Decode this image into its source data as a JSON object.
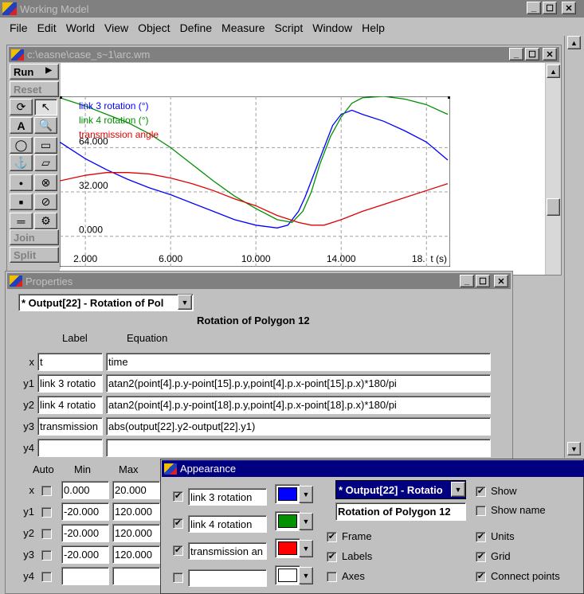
{
  "app": {
    "title": "Working Model"
  },
  "menu": [
    "File",
    "Edit",
    "World",
    "View",
    "Object",
    "Define",
    "Measure",
    "Script",
    "Window",
    "Help"
  ],
  "doc": {
    "title": "c:\\easne\\case_s~1\\arc.wm"
  },
  "toolbar": {
    "run": "Run",
    "reset": "Reset",
    "join": "Join",
    "split": "Split"
  },
  "legend_tabs": [
    "lin",
    "lin",
    "tra"
  ],
  "chart_data": {
    "type": "line",
    "x_label": "t (s)",
    "xlim": [
      0.8,
      19.0
    ],
    "ylim": [
      -22,
      101
    ],
    "x_ticks": [
      {
        "v": 2,
        "label": "2.000"
      },
      {
        "v": 6,
        "label": "6.000"
      },
      {
        "v": 10,
        "label": "10.000"
      },
      {
        "v": 14,
        "label": "14.000"
      },
      {
        "v": 18,
        "label": "18.000"
      }
    ],
    "x_unit_label": "t (s)",
    "y_ticks": [
      {
        "v": 0,
        "label": "0.000"
      },
      {
        "v": 32,
        "label": "32.000"
      },
      {
        "v": 64,
        "label": "64.000"
      }
    ],
    "series": [
      {
        "name": "link 3 rotation (°)",
        "color": "#0000ff",
        "x": [
          0.8,
          2,
          3,
          4,
          5,
          6,
          7,
          8,
          9,
          10,
          11,
          11.5,
          12,
          12.3,
          12.6,
          13,
          13.3,
          13.6,
          14,
          14.5,
          15,
          16,
          17,
          18,
          19
        ],
        "y": [
          68,
          56,
          48,
          41,
          35,
          30,
          24,
          18,
          12,
          8,
          6,
          8,
          18,
          28,
          40,
          56,
          68,
          80,
          88,
          91,
          88,
          83,
          76,
          68,
          55
        ]
      },
      {
        "name": "link 4 rotation (°)",
        "color": "#009000",
        "x": [
          0.8,
          2,
          3,
          4,
          5,
          6,
          7,
          8,
          9,
          10,
          11,
          11.7,
          12.2,
          12.6,
          13,
          13.5,
          14,
          14.5,
          15,
          16,
          17,
          18,
          19
        ],
        "y": [
          100,
          94,
          88,
          82,
          74,
          64,
          52,
          40,
          29,
          20,
          12,
          10,
          18,
          32,
          52,
          72,
          86,
          96,
          100,
          101,
          99,
          95,
          88
        ]
      },
      {
        "name": "transmission angle",
        "color": "#e00000",
        "x": [
          0.8,
          2,
          3,
          4,
          5,
          6,
          7,
          8,
          9,
          10,
          11,
          12,
          12.6,
          13.2,
          14,
          15,
          16,
          17,
          18,
          19
        ],
        "y": [
          40,
          44,
          46,
          46,
          45,
          42,
          38,
          33,
          27,
          22,
          15,
          10,
          8,
          8,
          12,
          18,
          23,
          28,
          33,
          38
        ]
      }
    ]
  },
  "properties": {
    "title": "Properties",
    "selector": "* Output[22] - Rotation of Pol",
    "heading": "Rotation of Polygon 12",
    "col_label": "Label",
    "col_equation": "Equation",
    "rows": [
      {
        "key": "x",
        "label": "t",
        "equation": "time"
      },
      {
        "key": "y1",
        "label": "link 3 rotatio",
        "equation": "atan2(point[4].p.y-point[15].p.y,point[4].p.x-point[15].p.x)*180/pi"
      },
      {
        "key": "y2",
        "label": "link 4 rotatio",
        "equation": "atan2(point[4].p.y-point[18].p.y,point[4].p.x-point[18].p.x)*180/pi"
      },
      {
        "key": "y3",
        "label": "transmission",
        "equation": "abs(output[22].y2-output[22].y1)"
      },
      {
        "key": "y4",
        "label": "",
        "equation": ""
      }
    ],
    "col_auto": "Auto",
    "col_min": "Min",
    "col_max": "Max",
    "ranges": [
      {
        "key": "x",
        "min": "0.000",
        "max": "20.000"
      },
      {
        "key": "y1",
        "min": "-20.000",
        "max": "120.000"
      },
      {
        "key": "y2",
        "min": "-20.000",
        "max": "120.000"
      },
      {
        "key": "y3",
        "min": "-20.000",
        "max": "120.000"
      },
      {
        "key": "y4",
        "min": "",
        "max": ""
      }
    ]
  },
  "appearance": {
    "title": "Appearance",
    "series": [
      {
        "checked": "✔",
        "name": "link 3 rotation",
        "color": "#0000ff"
      },
      {
        "checked": "✔",
        "name": "link 4 rotation",
        "color": "#009000"
      },
      {
        "checked": "✔",
        "name": "transmission an",
        "color": "#ff0000"
      },
      {
        "checked": "",
        "name": "",
        "color": "#ffffff"
      }
    ],
    "selector": "* Output[22] - Rotatio",
    "name_field": "Rotation of Polygon 12",
    "show": "Show",
    "show_name": "Show name",
    "frame": "Frame",
    "labels": "Labels",
    "axes": "Axes",
    "units": "Units",
    "grid": "Grid",
    "connect_points": "Connect points",
    "check": "✔"
  }
}
